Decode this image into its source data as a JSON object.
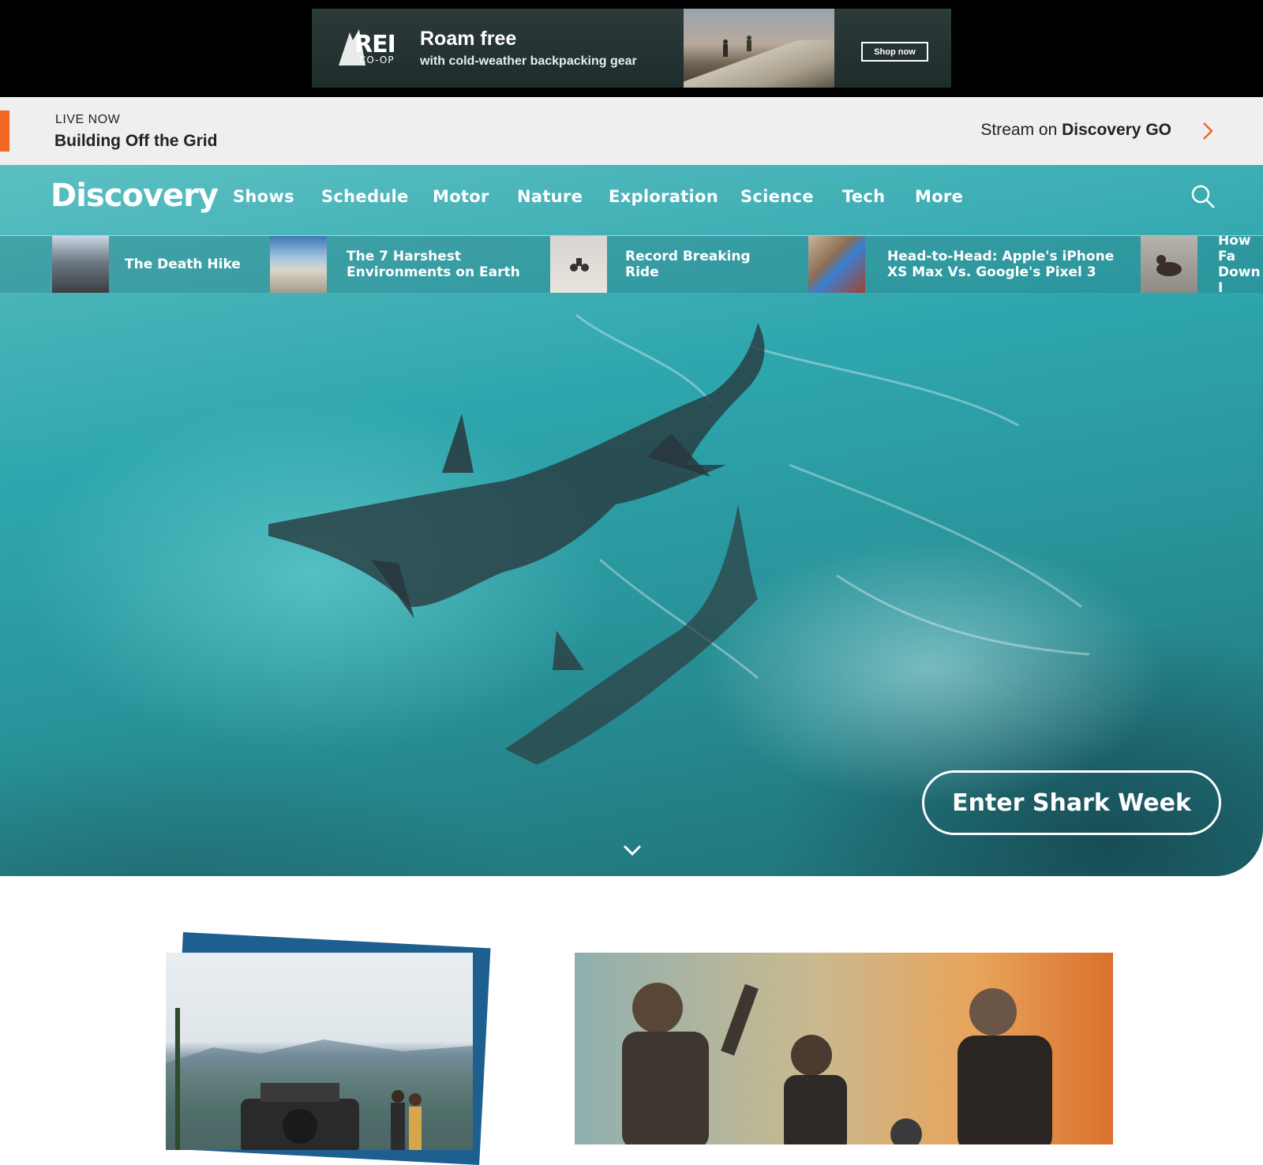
{
  "ad": {
    "brand_name": "REI",
    "brand_sub": "CO-OP",
    "headline": "Roam free",
    "subline": "with cold-weather backpacking gear",
    "cta": "Shop now"
  },
  "live": {
    "label": "LIVE NOW",
    "title": "Building Off the Grid",
    "stream_prefix": "Stream on ",
    "stream_brand": "Discovery GO"
  },
  "nav": {
    "logo": "Discovery",
    "items": [
      "Shows",
      "Schedule",
      "Motor",
      "Nature",
      "Exploration",
      "Science",
      "Tech",
      "More"
    ]
  },
  "strip": {
    "cards": [
      {
        "title": "The Death Hike"
      },
      {
        "title": "The 7 Harshest\nEnvironments on Earth"
      },
      {
        "title": "Record Breaking Ride"
      },
      {
        "title": "Head-to-Head: Apple's iPhone\nXS Max Vs. Google's Pixel 3"
      },
      {
        "title": "How Fa\nDown I"
      }
    ]
  },
  "hero": {
    "cta": "Enter Shark Week"
  },
  "colors": {
    "accent": "#f26722",
    "feature_blue": "#1d5f8f",
    "ad_background": "#000000"
  },
  "icons": [
    "rei-logo-icon",
    "chevron-right-icon",
    "search-icon",
    "chevron-down-icon"
  ]
}
